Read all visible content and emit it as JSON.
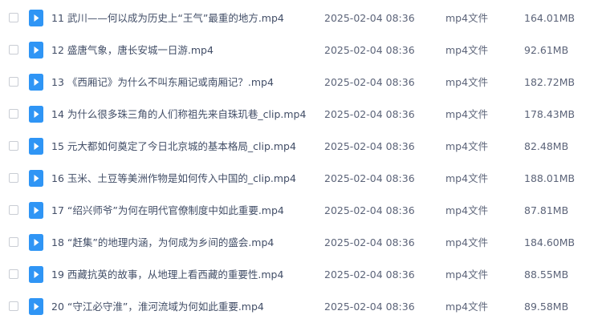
{
  "colors": {
    "icon": "#2f95f5",
    "text": "#424e67",
    "meta_text": "#5c6479",
    "checkbox_border": "#c9cdd4"
  },
  "icons": {
    "file": "video-file-icon",
    "checkbox": "checkbox-icon"
  },
  "files": [
    {
      "name": "11 武川——何以成为历史上“王气”最重的地方.mp4",
      "date": "2025-02-04 08:36",
      "type": "mp4文件",
      "size": "164.01MB"
    },
    {
      "name": "12 盛唐气象，唐长安城一日游.mp4",
      "date": "2025-02-04 08:36",
      "type": "mp4文件",
      "size": "92.61MB"
    },
    {
      "name": "13 《西厢记》为什么不叫东厢记或南厢记？.mp4",
      "date": "2025-02-04 08:36",
      "type": "mp4文件",
      "size": "182.72MB"
    },
    {
      "name": "14 为什么很多珠三角的人们称祖先来自珠玑巷_clip.mp4",
      "date": "2025-02-04 08:36",
      "type": "mp4文件",
      "size": "178.43MB"
    },
    {
      "name": "15 元大都如何奠定了今日北京城的基本格局_clip.mp4",
      "date": "2025-02-04 08:36",
      "type": "mp4文件",
      "size": "82.48MB"
    },
    {
      "name": "16 玉米、土豆等美洲作物是如何传入中国的_clip.mp4",
      "date": "2025-02-04 08:36",
      "type": "mp4文件",
      "size": "188.01MB"
    },
    {
      "name": "17 “绍兴师爷”为何在明代官僚制度中如此重要.mp4",
      "date": "2025-02-04 08:36",
      "type": "mp4文件",
      "size": "87.81MB"
    },
    {
      "name": "18 “赶集”的地理内涵，为何成为乡间的盛会.mp4",
      "date": "2025-02-04 08:36",
      "type": "mp4文件",
      "size": "184.60MB"
    },
    {
      "name": "19 西藏抗英的故事，从地理上看西藏的重要性.mp4",
      "date": "2025-02-04 08:36",
      "type": "mp4文件",
      "size": "88.55MB"
    },
    {
      "name": "20 “守江必守淮”，淮河流域为何如此重要.mp4",
      "date": "2025-02-04 08:36",
      "type": "mp4文件",
      "size": "89.58MB"
    }
  ]
}
